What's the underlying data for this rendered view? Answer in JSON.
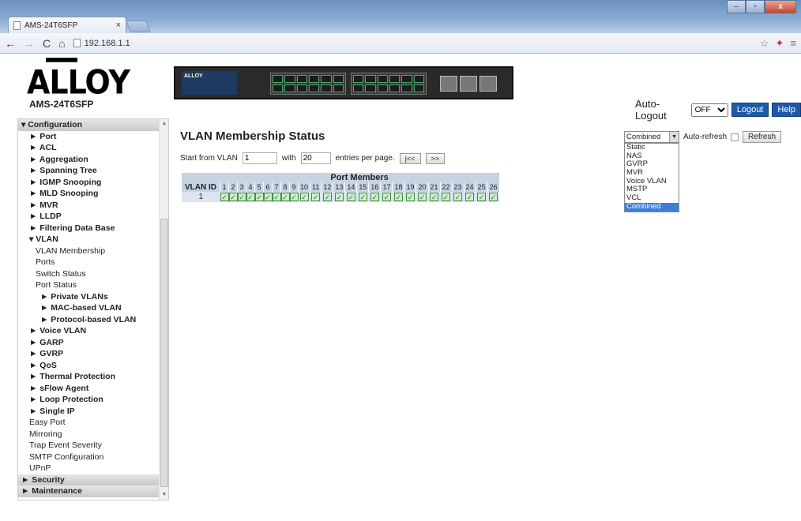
{
  "browser": {
    "tab_title": "AMS-24T6SFP",
    "tab_close": "×",
    "url": "192.168.1.1"
  },
  "header": {
    "logo_text": "ALLOY",
    "model": "AMS-24T6SFP",
    "autologout_label": "Auto-Logout",
    "autologout_value": "OFF",
    "logout_label": "Logout",
    "help_label": "Help"
  },
  "sidebar": {
    "items": [
      {
        "label": "▾ Configuration",
        "style": "header"
      },
      {
        "label": "► Port",
        "style": "bold"
      },
      {
        "label": "► ACL",
        "style": "bold"
      },
      {
        "label": "► Aggregation",
        "style": "bold"
      },
      {
        "label": "► Spanning Tree",
        "style": "bold"
      },
      {
        "label": "► IGMP Snooping",
        "style": "bold"
      },
      {
        "label": "► MLD Snooping",
        "style": "bold"
      },
      {
        "label": "► MVR",
        "style": "bold"
      },
      {
        "label": "► LLDP",
        "style": "bold"
      },
      {
        "label": "► Filtering Data Base",
        "style": "bold"
      },
      {
        "label": "▾ VLAN",
        "style": "bold"
      },
      {
        "label": "VLAN Membership",
        "style": "l3"
      },
      {
        "label": "Ports",
        "style": "l3"
      },
      {
        "label": "Switch Status",
        "style": "l3"
      },
      {
        "label": "Port Status",
        "style": "l3"
      },
      {
        "label": "► Private VLANs",
        "style": "l3b"
      },
      {
        "label": "► MAC-based VLAN",
        "style": "l3b"
      },
      {
        "label": "► Protocol-based VLAN",
        "style": "l3b"
      },
      {
        "label": "► Voice VLAN",
        "style": "bold"
      },
      {
        "label": "► GARP",
        "style": "bold"
      },
      {
        "label": "► GVRP",
        "style": "bold"
      },
      {
        "label": "► QoS",
        "style": "bold"
      },
      {
        "label": "► Thermal Protection",
        "style": "bold"
      },
      {
        "label": "► sFlow Agent",
        "style": "bold"
      },
      {
        "label": "► Loop Protection",
        "style": "bold"
      },
      {
        "label": "► Single IP",
        "style": "bold"
      },
      {
        "label": "Easy Port",
        "style": "plain"
      },
      {
        "label": "Mirroring",
        "style": "plain"
      },
      {
        "label": "Trap Event Severity",
        "style": "plain"
      },
      {
        "label": "SMTP Configuration",
        "style": "plain"
      },
      {
        "label": "UPnP",
        "style": "plain"
      },
      {
        "label": "► Security",
        "style": "header"
      },
      {
        "label": "► Maintenance",
        "style": "header"
      }
    ]
  },
  "main": {
    "title": "VLAN Membership Status",
    "start_label": "Start from VLAN",
    "start_value": "1",
    "with_label": "with",
    "with_value": "20",
    "entries_label": "entries per page.",
    "first_btn": "|<<",
    "next_btn": ">>",
    "table": {
      "vlan_id_header": "VLAN ID",
      "port_members_header": "Port Members",
      "ports": [
        "1",
        "2",
        "3",
        "4",
        "5",
        "6",
        "7",
        "8",
        "9",
        "10",
        "11",
        "12",
        "13",
        "14",
        "15",
        "16",
        "17",
        "18",
        "19",
        "20",
        "21",
        "22",
        "23",
        "24",
        "25",
        "26"
      ],
      "rows": [
        {
          "vlan_id": "1",
          "members": 26
        }
      ]
    }
  },
  "controls": {
    "user_select": "Combined",
    "auto_refresh_label": "Auto-refresh",
    "refresh_label": "Refresh",
    "options": [
      "Static",
      "NAS",
      "GVRP",
      "MVR",
      "Voice VLAN",
      "MSTP",
      "VCL",
      "Combined"
    ],
    "selected_option": "Combined"
  }
}
